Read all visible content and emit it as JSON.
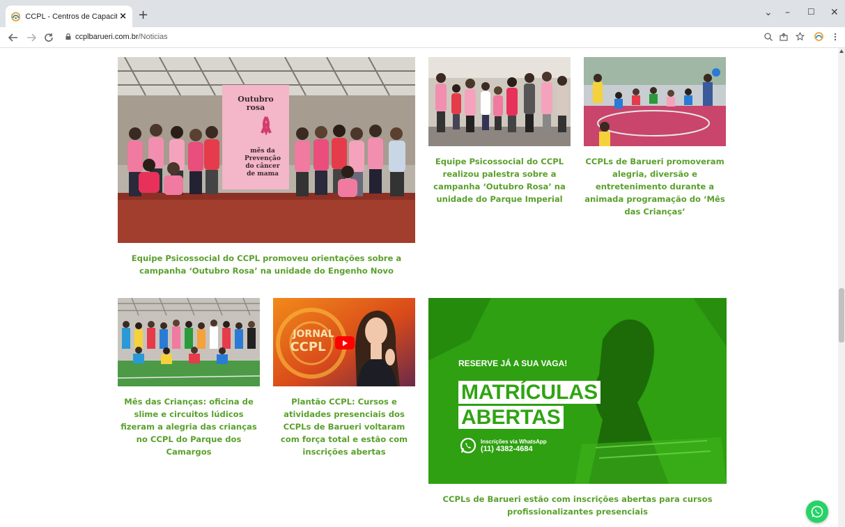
{
  "browser": {
    "tab_title": "CCPL - Centros de Capacitação P",
    "tab_close": "×",
    "new_tab": "+",
    "url_domain": "ccplbarueri.com.br",
    "url_path": "/Noticias",
    "window_minimize": "–",
    "window_maximize": "☐",
    "window_close": "✕",
    "window_menu": "⌄"
  },
  "news": [
    {
      "caption": "Equipe Psicossocial do CCPL promoveu orientações sobre a campanha ‘Outubro Rosa’ na unidade do Engenho Novo",
      "image_kind": "outubro-rosa-group-photo"
    },
    {
      "caption": "Equipe Psicossocial do CCPL realizou palestra sobre a campanha ‘Outubro Rosa’ na unidade do Parque Imperial",
      "image_kind": "group-photo-pink"
    },
    {
      "caption": "CCPLs de Barueri promoveram alegria, diversão e entretenimento durante a animada programação do ‘Mês das Crianças’",
      "image_kind": "children-activity"
    },
    {
      "caption": "Mês das Crianças: oficina de slime e circuitos lúdicos fizeram a alegria das crianças no CCPL do Parque dos Camargos",
      "image_kind": "children-group-gym"
    },
    {
      "caption": "Plantão CCPL: Cursos e atividades presenciais dos CCPLs de Barueri voltaram com força total e estão com inscrições abertas",
      "image_kind": "video-thumbnail"
    },
    {
      "caption": "CCPLs de Barueri estão com inscrições abertas para cursos profissionalizantes presenciais",
      "image_kind": "matriculas-banner"
    }
  ],
  "poster": {
    "title_line1": "Outubro",
    "title_line2": "rosa",
    "sub_line1": "mês da",
    "sub_line2": "Prevenção",
    "sub_line3": "do câncer",
    "sub_line4": "de mama"
  },
  "video": {
    "logo_line1": "JORNAL",
    "logo_line2": "CCPL"
  },
  "banner": {
    "reserve": "RESERVE JÁ A SUA VAGA!",
    "line1": "MATRÍCULAS",
    "line2": "ABERTAS",
    "wa_label": "Inscrições via WhatsApp",
    "wa_phone": "(11) 4382-4684"
  },
  "colors": {
    "caption_green": "#5aa02c",
    "banner_green": "#2fa412",
    "whatsapp": "#25d366"
  }
}
